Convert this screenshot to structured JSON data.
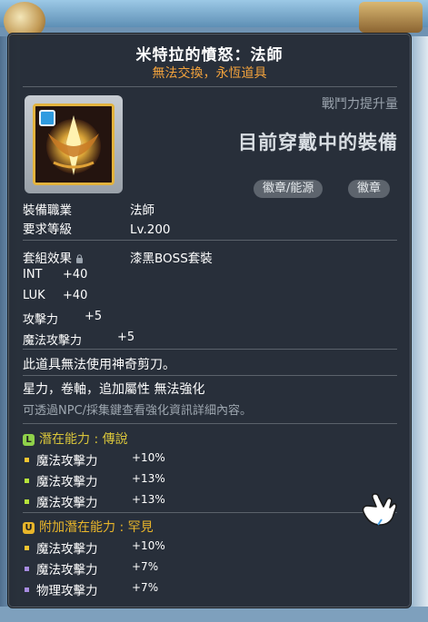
{
  "tooltip": {
    "title": "米特拉的憤怒：法師",
    "subtitle": "無法交換，永恆道具",
    "power_label": "戰鬥力提升量",
    "equipped_label": "目前穿戴中的裝備",
    "pills": [
      "徽章/能源",
      "徽章"
    ],
    "job_label": "裝備職業",
    "job_value": "法師",
    "level_label": "要求等級",
    "level_value": "Lv.200",
    "set_label": "套組效果",
    "set_value": "漆黑BOSS套裝",
    "stats": [
      {
        "name": "INT",
        "value": "+40"
      },
      {
        "name": "LUK",
        "value": "+40"
      },
      {
        "name": "攻擊力",
        "value": "+5"
      },
      {
        "name": "魔法攻擊力",
        "value": "+5"
      }
    ],
    "note1": "此道具無法使用神奇剪刀。",
    "note2": "星力，卷軸，追加屬性 無法強化",
    "note3": "可透過NPC/採集鍵查看強化資訊詳細內容。",
    "potential": {
      "badge": "L",
      "header": "潛在能力 : 傳說",
      "lines": [
        {
          "name": "魔法攻擊力",
          "value": "+10%"
        },
        {
          "name": "魔法攻擊力",
          "value": "+13%"
        },
        {
          "name": "魔法攻擊力",
          "value": "+13%"
        }
      ]
    },
    "additional": {
      "badge": "U",
      "header": "附加潛在能力 : 罕見",
      "lines": [
        {
          "name": "魔法攻擊力",
          "value": "+10%"
        },
        {
          "name": "魔法攻擊力",
          "value": "+7%"
        },
        {
          "name": "物理攻擊力",
          "value": "+7%"
        }
      ]
    }
  },
  "colors": {
    "legendary": "#d9c53a",
    "unique": "#e8b52a",
    "subtitle": "#f2a23c"
  }
}
